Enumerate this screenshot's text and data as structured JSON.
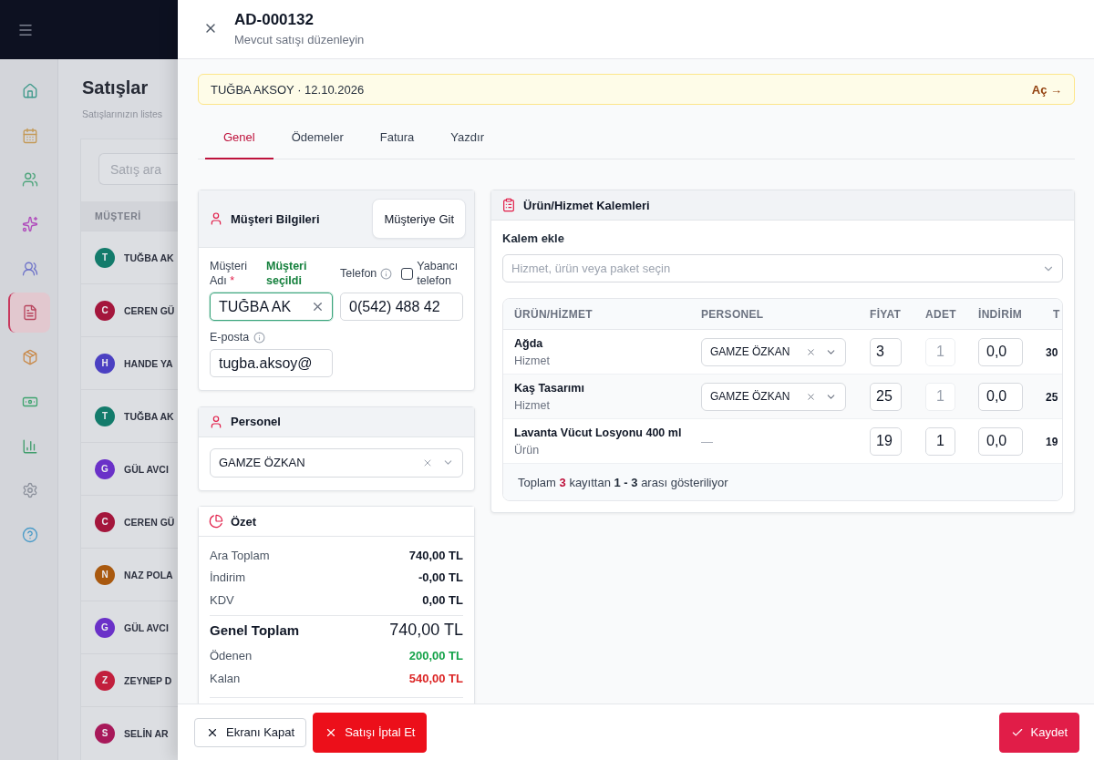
{
  "background_page": {
    "sidebar": {
      "items": [
        {
          "selected": false
        },
        {
          "selected": false
        },
        {
          "selected": false
        },
        {
          "selected": false
        },
        {
          "selected": false
        },
        {
          "selected": true
        },
        {
          "selected": false
        },
        {
          "selected": false
        },
        {
          "selected": false
        },
        {
          "selected": false
        },
        {
          "selected": false
        }
      ]
    },
    "title": "Satışlar",
    "subtitle": "Satışlarınızın listes",
    "search": {
      "placeholder": "Satış ara"
    },
    "table": {
      "columns": [
        "MÜŞTERİ"
      ],
      "rows": [
        {
          "initial": "T",
          "color": "#137b6b",
          "name": "TUĞBA AK"
        },
        {
          "initial": "C",
          "color": "#a4163c",
          "name": "CEREN GÜ"
        },
        {
          "initial": "H",
          "color": "#4b40c2",
          "name": "HANDE YA"
        },
        {
          "initial": "T",
          "color": "#137b6b",
          "name": "TUĞBA AK"
        },
        {
          "initial": "G",
          "color": "#6a31c8",
          "name": "GÜL AVCI"
        },
        {
          "initial": "C",
          "color": "#a4163c",
          "name": "CEREN GÜ"
        },
        {
          "initial": "N",
          "color": "#a9590f",
          "name": "NAZ POLA"
        },
        {
          "initial": "G",
          "color": "#6a31c8",
          "name": "GÜL AVCI"
        },
        {
          "initial": "Z",
          "color": "#c21f3d",
          "name": "ZEYNEP D"
        },
        {
          "initial": "S",
          "color": "#a8195a",
          "name": "SELİN AR"
        }
      ]
    }
  },
  "drawer": {
    "title": "AD-000132",
    "subtitle": "Mevcut satışı düzenleyin",
    "banner": {
      "text": "TUĞBA AKSOY · 12.10.2026",
      "link": "Aç →"
    },
    "tabs": [
      {
        "label": "Genel",
        "selected": true
      },
      {
        "label": "Ödemeler",
        "selected": false
      },
      {
        "label": "Fatura",
        "selected": false
      },
      {
        "label": "Yazdır",
        "selected": false
      }
    ],
    "customer_card": {
      "title": "Müşteri Bilgileri",
      "button": "Müşteriye Git",
      "name_field": {
        "label": "Müşteri Adı",
        "required_mark": "*",
        "status": "Müşteri seçildi",
        "value": "TUĞBA AK",
        "valid": true
      },
      "phone_field": {
        "label": "Telefon",
        "value": "0(542) 488 42"
      },
      "foreign_phone": {
        "label": "Yabancı telefon",
        "checked": false
      },
      "email_field": {
        "label": "E-posta",
        "value": "tugba.aksoy@"
      }
    },
    "staff_card": {
      "title": "Personel",
      "select": {
        "value": "GAMZE ÖZKAN"
      }
    },
    "summary_card": {
      "title": "Özet",
      "rows": [
        {
          "kind": "normal",
          "label": "Ara Toplam",
          "value": "740,00 TL"
        },
        {
          "kind": "normal",
          "label": "İndirim",
          "value": "-0,00 TL"
        },
        {
          "kind": "normal",
          "label": "KDV",
          "value": "0,00 TL"
        },
        {
          "kind": "grand",
          "label": "Genel Toplam",
          "value": "740,00 TL"
        },
        {
          "kind": "paid",
          "label": "Ödenen",
          "value": "200,00 TL"
        },
        {
          "kind": "due",
          "label": "Kalan",
          "value": "540,00 TL"
        }
      ]
    },
    "items_card": {
      "title": "Ürün/Hizmet Kalemleri",
      "add_label": "Kalem ekle",
      "add_select": {
        "placeholder": "Hizmet, ürün veya paket seçin"
      },
      "table": {
        "columns": [
          "ÜRÜN/HİZMET",
          "PERSONEL",
          "FİYAT",
          "ADET",
          "İNDİRİM",
          "T"
        ],
        "rows": [
          {
            "name": "Ağda",
            "type": "Hizmet",
            "staff": {
              "kind": "select",
              "value": "GAMZE ÖZKAN"
            },
            "price": "3",
            "quantity": {
              "value": "1",
              "disabled": true
            },
            "discount": "0,0",
            "total": "30"
          },
          {
            "name": "Kaş Tasarımı",
            "type": "Hizmet",
            "staff": {
              "kind": "select",
              "value": "GAMZE ÖZKAN"
            },
            "price": "25",
            "quantity": {
              "value": "1",
              "disabled": true
            },
            "discount": "0,0",
            "total": "25"
          },
          {
            "name": "Lavanta Vücut Losyonu 400 ml",
            "type": "Ürün",
            "staff": {
              "kind": "empty",
              "value": "—"
            },
            "price": "19",
            "quantity": {
              "value": "1",
              "disabled": false
            },
            "discount": "0,0",
            "total": "19"
          }
        ],
        "footer": "Toplam **3** kayıttan **1 - 3** arası gösteriliyor"
      }
    },
    "footer": {
      "buttons": [
        {
          "kind": "outline",
          "label": "Ekranı Kapat"
        },
        {
          "kind": "danger",
          "label": "Satışı İptal Et"
        },
        {
          "kind": "primary",
          "label": "Kaydet"
        }
      ]
    }
  }
}
